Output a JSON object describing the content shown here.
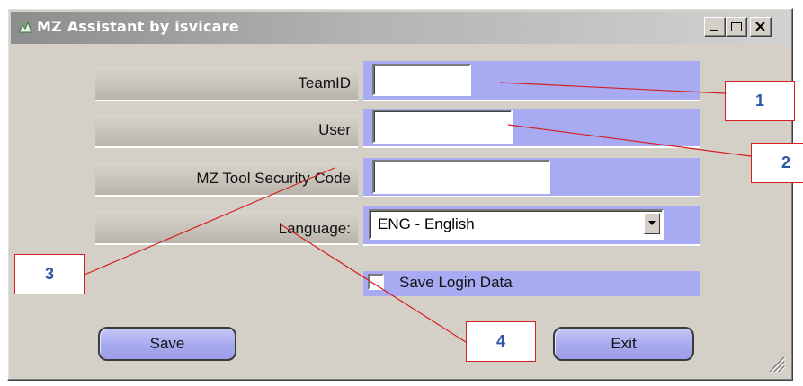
{
  "window": {
    "title": "MZ Assistant by isvicare"
  },
  "titlebar_buttons": {
    "minimize_icon": "minimize-icon",
    "maximize_icon": "maximize-icon",
    "close_icon": "close-icon"
  },
  "form": {
    "team_id_label": "TeamID",
    "team_id_value": "",
    "user_label": "User",
    "user_value": "",
    "security_code_label": "MZ Tool Security Code",
    "security_code_value": "",
    "language_label": "Language:",
    "language_selected": "ENG - English",
    "save_login_label": "Save Login Data",
    "save_login_checked": false
  },
  "buttons": {
    "save_label": "Save",
    "exit_label": "Exit"
  },
  "callouts": [
    "1",
    "2",
    "3",
    "4"
  ],
  "colors": {
    "accent_blue": "#a8aaf2",
    "callout_border": "#d42020",
    "callout_text": "#2b56a8"
  }
}
